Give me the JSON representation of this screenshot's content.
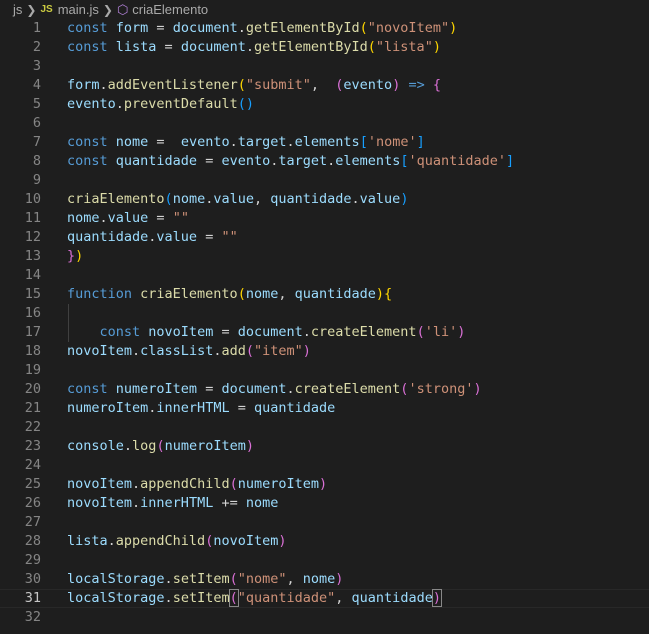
{
  "breadcrumb": {
    "folder": "js",
    "file_badge": "JS",
    "file": "main.js",
    "symbol": "criaElemento"
  },
  "icons": {
    "chevron": "chevron-right-icon",
    "symbol": "symbol-method-icon"
  },
  "colors": {
    "background": "#1e1e1e",
    "keyword": "#569cd6",
    "variable": "#9cdcfe",
    "function": "#dcdcaa",
    "string": "#ce9178",
    "line_number": "#858585"
  },
  "current_line": 31,
  "lines": [
    {
      "n": "1",
      "t": [
        [
          "k",
          "const "
        ],
        [
          "v",
          "form"
        ],
        [
          "p",
          " = "
        ],
        [
          "v",
          "document"
        ],
        [
          "p",
          "."
        ],
        [
          "f",
          "getElementById"
        ],
        [
          "b1",
          "("
        ],
        [
          "s",
          "\"novoItem\""
        ],
        [
          "b1",
          ")"
        ]
      ]
    },
    {
      "n": "2",
      "t": [
        [
          "k",
          "const "
        ],
        [
          "v",
          "lista"
        ],
        [
          "p",
          " = "
        ],
        [
          "v",
          "document"
        ],
        [
          "p",
          "."
        ],
        [
          "f",
          "getElementById"
        ],
        [
          "b1",
          "("
        ],
        [
          "s",
          "\"lista\""
        ],
        [
          "b1",
          ")"
        ]
      ]
    },
    {
      "n": "3",
      "t": []
    },
    {
      "n": "4",
      "t": [
        [
          "v",
          "form"
        ],
        [
          "p",
          "."
        ],
        [
          "f",
          "addEventListener"
        ],
        [
          "b1",
          "("
        ],
        [
          "s",
          "\"submit\""
        ],
        [
          "p",
          ",  "
        ],
        [
          "b2",
          "("
        ],
        [
          "v",
          "evento"
        ],
        [
          "b2",
          ")"
        ],
        [
          "p",
          " "
        ],
        [
          "k",
          "=>"
        ],
        [
          "p",
          " "
        ],
        [
          "b2",
          "{"
        ]
      ]
    },
    {
      "n": "5",
      "t": [
        [
          "v",
          "evento"
        ],
        [
          "p",
          "."
        ],
        [
          "f",
          "preventDefault"
        ],
        [
          "b3",
          "()"
        ]
      ]
    },
    {
      "n": "6",
      "t": []
    },
    {
      "n": "7",
      "t": [
        [
          "k",
          "const "
        ],
        [
          "v",
          "nome"
        ],
        [
          "p",
          " =  "
        ],
        [
          "v",
          "evento"
        ],
        [
          "p",
          "."
        ],
        [
          "v",
          "target"
        ],
        [
          "p",
          "."
        ],
        [
          "v",
          "elements"
        ],
        [
          "b3",
          "["
        ],
        [
          "s",
          "'nome'"
        ],
        [
          "b3",
          "]"
        ]
      ]
    },
    {
      "n": "8",
      "t": [
        [
          "k",
          "const "
        ],
        [
          "v",
          "quantidade"
        ],
        [
          "p",
          " = "
        ],
        [
          "v",
          "evento"
        ],
        [
          "p",
          "."
        ],
        [
          "v",
          "target"
        ],
        [
          "p",
          "."
        ],
        [
          "v",
          "elements"
        ],
        [
          "b3",
          "["
        ],
        [
          "s",
          "'quantidade'"
        ],
        [
          "b3",
          "]"
        ]
      ]
    },
    {
      "n": "9",
      "t": []
    },
    {
      "n": "10",
      "t": [
        [
          "f",
          "criaElemento"
        ],
        [
          "b3",
          "("
        ],
        [
          "v",
          "nome"
        ],
        [
          "p",
          "."
        ],
        [
          "v",
          "value"
        ],
        [
          "p",
          ", "
        ],
        [
          "v",
          "quantidade"
        ],
        [
          "p",
          "."
        ],
        [
          "v",
          "value"
        ],
        [
          "b3",
          ")"
        ]
      ]
    },
    {
      "n": "11",
      "t": [
        [
          "v",
          "nome"
        ],
        [
          "p",
          "."
        ],
        [
          "v",
          "value"
        ],
        [
          "p",
          " = "
        ],
        [
          "s",
          "\"\""
        ]
      ]
    },
    {
      "n": "12",
      "t": [
        [
          "v",
          "quantidade"
        ],
        [
          "p",
          "."
        ],
        [
          "v",
          "value"
        ],
        [
          "p",
          " = "
        ],
        [
          "s",
          "\"\""
        ]
      ]
    },
    {
      "n": "13",
      "t": [
        [
          "b2",
          "}"
        ],
        [
          "b1",
          ")"
        ]
      ]
    },
    {
      "n": "14",
      "t": []
    },
    {
      "n": "15",
      "t": [
        [
          "k",
          "function "
        ],
        [
          "f",
          "criaElemento"
        ],
        [
          "b1",
          "("
        ],
        [
          "v",
          "nome"
        ],
        [
          "p",
          ", "
        ],
        [
          "v",
          "quantidade"
        ],
        [
          "b1",
          ")"
        ],
        [
          "b1",
          "{"
        ]
      ]
    },
    {
      "n": "16",
      "t": [],
      "guide": true
    },
    {
      "n": "17",
      "t": [
        [
          "p",
          "    "
        ],
        [
          "k",
          "const "
        ],
        [
          "v",
          "novoItem"
        ],
        [
          "p",
          " = "
        ],
        [
          "v",
          "document"
        ],
        [
          "p",
          "."
        ],
        [
          "f",
          "createElement"
        ],
        [
          "b2",
          "("
        ],
        [
          "s",
          "'li'"
        ],
        [
          "b2",
          ")"
        ]
      ],
      "guide": true
    },
    {
      "n": "18",
      "t": [
        [
          "v",
          "novoItem"
        ],
        [
          "p",
          "."
        ],
        [
          "v",
          "classList"
        ],
        [
          "p",
          "."
        ],
        [
          "f",
          "add"
        ],
        [
          "b2",
          "("
        ],
        [
          "s",
          "\"item\""
        ],
        [
          "b2",
          ")"
        ]
      ]
    },
    {
      "n": "19",
      "t": []
    },
    {
      "n": "20",
      "t": [
        [
          "k",
          "const "
        ],
        [
          "v",
          "numeroItem"
        ],
        [
          "p",
          " = "
        ],
        [
          "v",
          "document"
        ],
        [
          "p",
          "."
        ],
        [
          "f",
          "createElement"
        ],
        [
          "b2",
          "("
        ],
        [
          "s",
          "'strong'"
        ],
        [
          "b2",
          ")"
        ]
      ]
    },
    {
      "n": "21",
      "t": [
        [
          "v",
          "numeroItem"
        ],
        [
          "p",
          "."
        ],
        [
          "v",
          "innerHTML"
        ],
        [
          "p",
          " = "
        ],
        [
          "v",
          "quantidade"
        ]
      ]
    },
    {
      "n": "22",
      "t": []
    },
    {
      "n": "23",
      "t": [
        [
          "v",
          "console"
        ],
        [
          "p",
          "."
        ],
        [
          "f",
          "log"
        ],
        [
          "b2",
          "("
        ],
        [
          "v",
          "numeroItem"
        ],
        [
          "b2",
          ")"
        ]
      ]
    },
    {
      "n": "24",
      "t": []
    },
    {
      "n": "25",
      "t": [
        [
          "v",
          "novoItem"
        ],
        [
          "p",
          "."
        ],
        [
          "f",
          "appendChild"
        ],
        [
          "b2",
          "("
        ],
        [
          "v",
          "numeroItem"
        ],
        [
          "b2",
          ")"
        ]
      ]
    },
    {
      "n": "26",
      "t": [
        [
          "v",
          "novoItem"
        ],
        [
          "p",
          "."
        ],
        [
          "v",
          "innerHTML"
        ],
        [
          "p",
          " += "
        ],
        [
          "v",
          "nome"
        ]
      ]
    },
    {
      "n": "27",
      "t": []
    },
    {
      "n": "28",
      "t": [
        [
          "v",
          "lista"
        ],
        [
          "p",
          "."
        ],
        [
          "f",
          "appendChild"
        ],
        [
          "b2",
          "("
        ],
        [
          "v",
          "novoItem"
        ],
        [
          "b2",
          ")"
        ]
      ]
    },
    {
      "n": "29",
      "t": []
    },
    {
      "n": "30",
      "t": [
        [
          "v",
          "localStorage"
        ],
        [
          "p",
          "."
        ],
        [
          "f",
          "setItem"
        ],
        [
          "b2",
          "("
        ],
        [
          "s",
          "\"nome\""
        ],
        [
          "p",
          ", "
        ],
        [
          "v",
          "nome"
        ],
        [
          "b2",
          ")"
        ]
      ]
    },
    {
      "n": "31",
      "t": [
        [
          "v",
          "localStorage"
        ],
        [
          "p",
          "."
        ],
        [
          "f",
          "setItem"
        ],
        [
          "b2m",
          "("
        ],
        [
          "s",
          "\"quantidade\""
        ],
        [
          "p",
          ", "
        ],
        [
          "v",
          "quantidade"
        ],
        [
          "b2m",
          ")"
        ]
      ]
    },
    {
      "n": "32",
      "t": []
    }
  ]
}
